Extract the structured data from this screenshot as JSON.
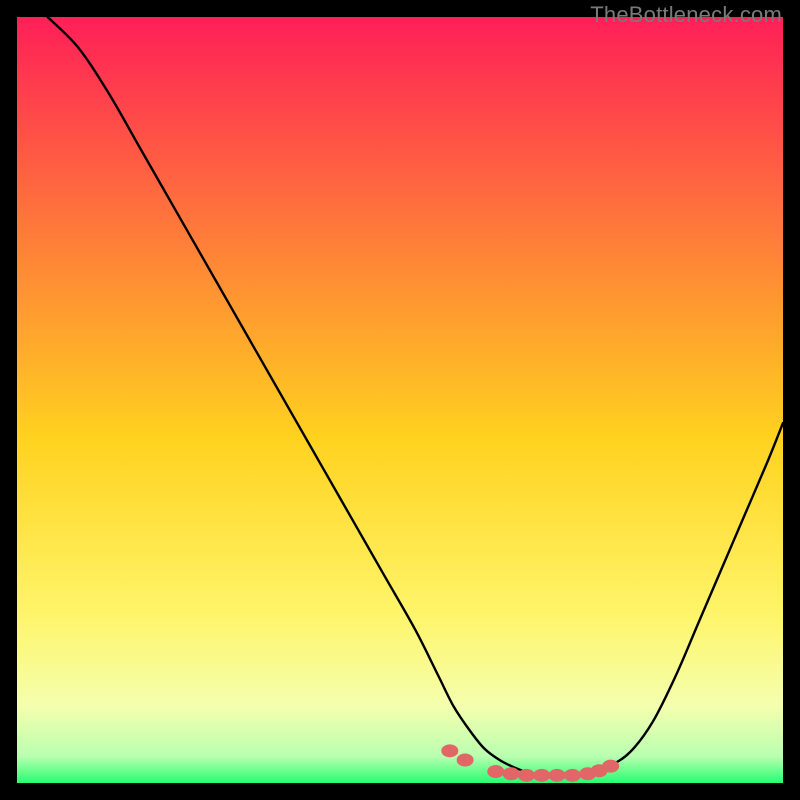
{
  "watermark": "TheBottleneck.com",
  "colors": {
    "gradient_top": "#ff1f57",
    "gradient_mid1": "#ff7a3a",
    "gradient_mid2": "#ffd21f",
    "gradient_mid3": "#fff56a",
    "gradient_mid4": "#f4ffae",
    "gradient_bottom": "#27ff70",
    "curve": "#000000",
    "dots": "#e16666",
    "frame": "#000000"
  },
  "chart_data": {
    "type": "line",
    "title": "",
    "xlabel": "",
    "ylabel": "",
    "xlim": [
      0,
      100
    ],
    "ylim": [
      0,
      100
    ],
    "series": [
      {
        "name": "bottleneck-curve",
        "x": [
          4,
          8,
          12,
          16,
          20,
          24,
          28,
          32,
          36,
          40,
          44,
          48,
          52,
          55,
          57,
          59,
          61,
          63,
          65,
          67,
          69,
          71,
          73,
          75,
          77,
          80,
          83,
          86,
          89,
          92,
          95,
          98,
          100
        ],
        "values": [
          100,
          96,
          90,
          83,
          76,
          69,
          62,
          55,
          48,
          41,
          34,
          27,
          20,
          14,
          10,
          7,
          4.5,
          3,
          2,
          1.3,
          1,
          1,
          1,
          1.3,
          2,
          4,
          8,
          14,
          21,
          28,
          35,
          42,
          47
        ]
      }
    ],
    "highlight_points": {
      "name": "flat-region-dots",
      "x": [
        56.5,
        58.5,
        62.5,
        64.5,
        66.5,
        68.5,
        70.5,
        72.5,
        74.5,
        76.0,
        77.5
      ],
      "values": [
        4.2,
        3.0,
        1.5,
        1.2,
        1.0,
        1.0,
        1.0,
        1.0,
        1.2,
        1.6,
        2.2
      ]
    }
  }
}
